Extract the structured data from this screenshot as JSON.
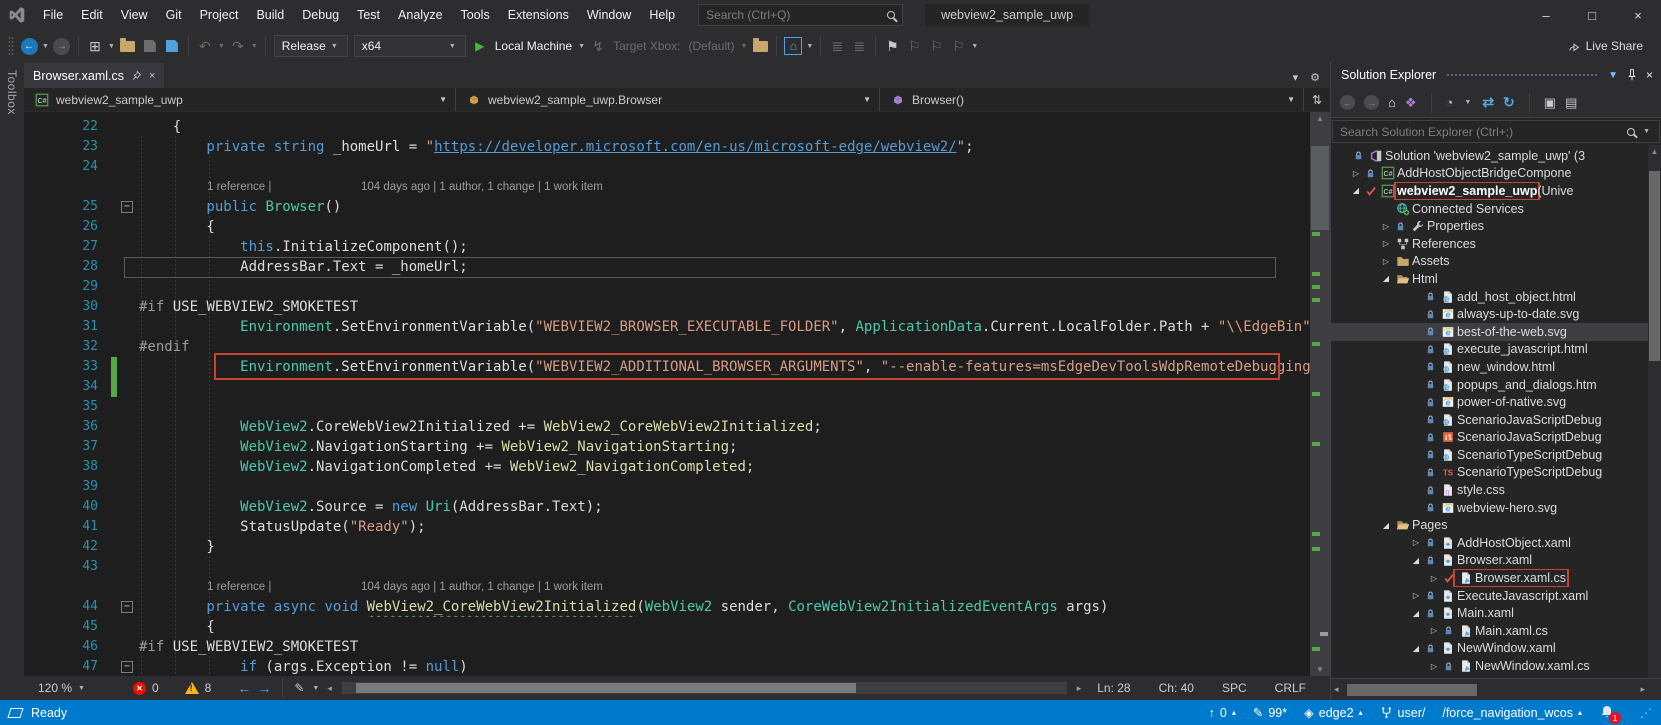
{
  "window": {
    "title": "webview2_sample_uwp"
  },
  "menu": {
    "items": [
      "File",
      "Edit",
      "View",
      "Git",
      "Project",
      "Build",
      "Debug",
      "Test",
      "Analyze",
      "Tools",
      "Extensions",
      "Window",
      "Help"
    ],
    "search_placeholder": "Search (Ctrl+Q)"
  },
  "toolbar": {
    "config": "Release",
    "platform": "x64",
    "run_target": "Local Machine",
    "target_xbox_label": "Target Xbox:",
    "target_xbox_value": "(Default)",
    "live_share_label": "Live Share",
    "icons": [
      "back-icon",
      "forward-icon",
      "new-item-icon",
      "open-folder-icon",
      "save-icon",
      "save-all-icon",
      "undo-icon",
      "redo-icon",
      "run-icon",
      "deploy-icon",
      "browse-folder-icon",
      "home-box-icon",
      "indent-icon",
      "outdent-icon",
      "bookmark-icon",
      "prev-bookmark-icon",
      "next-bookmark-icon",
      "clear-bookmarks-icon"
    ]
  },
  "toolbox_tab": "Toolbox",
  "editor": {
    "tab": {
      "label": "Browser.xaml.cs"
    },
    "breadcrumb": {
      "project": "webview2_sample_uwp",
      "type": "webview2_sample_uwp.Browser",
      "member": "Browser()"
    },
    "codelens": {
      "refs": "1 reference |",
      "meta": "104 days ago | 1 author, 1 change | 1 work item"
    },
    "bottom": {
      "zoom": "120 %",
      "errors": "0",
      "warnings": "8",
      "ln": "Ln: 28",
      "ch": "Ch: 40",
      "spc": "SPC",
      "crlf": "CRLF"
    },
    "lines": [
      {
        "n": 22,
        "ind": 4,
        "seg": [
          [
            "p",
            "{"
          ]
        ]
      },
      {
        "n": 23,
        "ind": 8,
        "seg": [
          [
            "k",
            "private"
          ],
          [
            "p",
            " "
          ],
          [
            "k",
            "string"
          ],
          [
            "p",
            " "
          ],
          [
            "p",
            "_homeUrl"
          ],
          [
            "p",
            " = "
          ],
          [
            "s",
            "\""
          ],
          [
            "u",
            "https://developer.microsoft.com/en-us/microsoft-edge/webview2/"
          ],
          [
            "s",
            "\""
          ],
          [
            "p",
            ";"
          ]
        ]
      },
      {
        "n": 24,
        "ind": 0,
        "seg": []
      },
      {
        "n": 25,
        "ind": 8,
        "cl": 1,
        "fold": 1,
        "seg": [
          [
            "k",
            "public"
          ],
          [
            "p",
            " "
          ],
          [
            "t",
            "Browser"
          ],
          [
            "p",
            "()"
          ]
        ]
      },
      {
        "n": 26,
        "ind": 8,
        "seg": [
          [
            "p",
            "{"
          ]
        ]
      },
      {
        "n": 27,
        "ind": 12,
        "seg": [
          [
            "k",
            "this"
          ],
          [
            "p",
            "."
          ],
          [
            "p",
            "InitializeComponent"
          ],
          [
            "p",
            "();"
          ]
        ]
      },
      {
        "n": 28,
        "ind": 12,
        "cur": 1,
        "seg": [
          [
            "p",
            "AddressBar.Text = _homeUrl;"
          ]
        ]
      },
      {
        "n": 29,
        "ind": 0,
        "seg": []
      },
      {
        "n": 30,
        "ind": 0,
        "seg": [
          [
            "d",
            "#if"
          ],
          [
            "p",
            " USE_WEBVIEW2_SMOKETEST"
          ]
        ]
      },
      {
        "n": 31,
        "ind": 12,
        "seg": [
          [
            "t",
            "Environment"
          ],
          [
            "p",
            "."
          ],
          [
            "p",
            "SetEnvironmentVariable"
          ],
          [
            "p",
            "("
          ],
          [
            "s",
            "\"WEBVIEW2_BROWSER_EXECUTABLE_FOLDER\""
          ],
          [
            "p",
            ", "
          ],
          [
            "t",
            "ApplicationData"
          ],
          [
            "p",
            ".Current.LocalFolder.Path + "
          ],
          [
            "s",
            "\"\\\\EdgeBin\""
          ],
          [
            "p",
            ");"
          ]
        ]
      },
      {
        "n": 32,
        "ind": 0,
        "seg": [
          [
            "d",
            "#endif"
          ]
        ]
      },
      {
        "n": 33,
        "ind": 12,
        "red": 1,
        "green": 1,
        "seg": [
          [
            "t",
            "Environment"
          ],
          [
            "p",
            "."
          ],
          [
            "p",
            "SetEnvironmentVariable"
          ],
          [
            "p",
            "("
          ],
          [
            "s",
            "\"WEBVIEW2_ADDITIONAL_BROWSER_ARGUMENTS\""
          ],
          [
            "p",
            ", "
          ],
          [
            "s",
            "\"--enable-features=msEdgeDevToolsWdpRemoteDebugging\""
          ],
          [
            "p",
            ");"
          ]
        ]
      },
      {
        "n": 34,
        "ind": 0,
        "green": 1,
        "seg": []
      },
      {
        "n": 35,
        "ind": 0,
        "seg": []
      },
      {
        "n": 36,
        "ind": 12,
        "seg": [
          [
            "t",
            "WebView2"
          ],
          [
            "p",
            ".CoreWebView2Initialized += "
          ],
          [
            "m",
            "WebView2_CoreWebView2Initialized"
          ],
          [
            "p",
            ";"
          ]
        ]
      },
      {
        "n": 37,
        "ind": 12,
        "seg": [
          [
            "t",
            "WebView2"
          ],
          [
            "p",
            ".NavigationStarting += "
          ],
          [
            "m",
            "WebView2_NavigationStarting"
          ],
          [
            "p",
            ";"
          ]
        ]
      },
      {
        "n": 38,
        "ind": 12,
        "seg": [
          [
            "t",
            "WebView2"
          ],
          [
            "p",
            ".NavigationCompleted += "
          ],
          [
            "m",
            "WebView2_NavigationCompleted"
          ],
          [
            "p",
            ";"
          ]
        ]
      },
      {
        "n": 39,
        "ind": 0,
        "seg": []
      },
      {
        "n": 40,
        "ind": 12,
        "seg": [
          [
            "t",
            "WebView2"
          ],
          [
            "p",
            ".Source = "
          ],
          [
            "k",
            "new"
          ],
          [
            "p",
            " "
          ],
          [
            "t",
            "Uri"
          ],
          [
            "p",
            "(AddressBar.Text);"
          ]
        ]
      },
      {
        "n": 41,
        "ind": 12,
        "seg": [
          [
            "p",
            "StatusUpdate("
          ],
          [
            "s",
            "\"Ready\""
          ],
          [
            "p",
            ");"
          ]
        ]
      },
      {
        "n": 42,
        "ind": 8,
        "seg": [
          [
            "p",
            "}"
          ]
        ]
      },
      {
        "n": 43,
        "ind": 0,
        "seg": []
      },
      {
        "n": 44,
        "ind": 8,
        "cl": 1,
        "fold": 1,
        "seg": [
          [
            "k",
            "private"
          ],
          [
            "p",
            " "
          ],
          [
            "k",
            "async"
          ],
          [
            "p",
            " "
          ],
          [
            "k",
            "void"
          ],
          [
            "p",
            " "
          ],
          [
            "g",
            "WebView2_CoreWebView2Initialized"
          ],
          [
            "p",
            "("
          ],
          [
            "t",
            "WebView2"
          ],
          [
            "p",
            " sender, "
          ],
          [
            "t",
            "CoreWebView2InitializedEventArgs"
          ],
          [
            "p",
            " args)"
          ]
        ]
      },
      {
        "n": 45,
        "ind": 8,
        "seg": [
          [
            "p",
            "{"
          ]
        ]
      },
      {
        "n": 46,
        "ind": 0,
        "seg": [
          [
            "d",
            "#if"
          ],
          [
            "p",
            " USE_WEBVIEW2_SMOKETEST"
          ]
        ]
      },
      {
        "n": 47,
        "ind": 12,
        "fold": 1,
        "seg": [
          [
            "k",
            "if"
          ],
          [
            "p",
            " (args.Exception != "
          ],
          [
            "k",
            "null"
          ],
          [
            "p",
            ")"
          ]
        ]
      }
    ]
  },
  "solution_explorer": {
    "title": "Solution Explorer",
    "search_placeholder": "Search Solution Explorer (Ctrl+;)",
    "toolbar_icons": [
      "back-icon",
      "forward-icon",
      "home-icon",
      "switch-views-icon",
      "pending-changes-filter-icon",
      "sync-icon",
      "refresh-icon",
      "nest-files-icon",
      "properties-icon"
    ],
    "items": [
      {
        "ind": 0,
        "lock": 1,
        "icon": "solution",
        "label": "Solution 'webview2_sample_uwp' (3"
      },
      {
        "ind": 1,
        "exp": "c",
        "lock": 1,
        "icon": "csproj",
        "label": "AddHostObjectBridgeCompone"
      },
      {
        "ind": 1,
        "exp": "o",
        "check": 1,
        "icon": "csproj",
        "label": "webview2_sample_uwp",
        "suffix": " (Unive",
        "bold": 1,
        "red": 1
      },
      {
        "ind": 2,
        "icon": "globe",
        "label": "Connected Services"
      },
      {
        "ind": 2,
        "exp": "c",
        "lock": 1,
        "icon": "wrench",
        "label": "Properties"
      },
      {
        "ind": 2,
        "exp": "c",
        "icon": "refs",
        "label": "References"
      },
      {
        "ind": 2,
        "exp": "c",
        "icon": "folder",
        "label": "Assets"
      },
      {
        "ind": 2,
        "exp": "o",
        "icon": "folder-open",
        "label": "Html"
      },
      {
        "ind": 3,
        "lock": 1,
        "icon": "html",
        "label": "add_host_object.html"
      },
      {
        "ind": 3,
        "lock": 1,
        "icon": "ie",
        "label": "always-up-to-date.svg"
      },
      {
        "ind": 3,
        "lock": 1,
        "icon": "ie",
        "label": "best-of-the-web.svg",
        "sel": 1
      },
      {
        "ind": 3,
        "lock": 1,
        "icon": "html",
        "label": "execute_javascript.html"
      },
      {
        "ind": 3,
        "lock": 1,
        "icon": "html",
        "label": "new_window.html"
      },
      {
        "ind": 3,
        "lock": 1,
        "icon": "html",
        "label": "popups_and_dialogs.htm"
      },
      {
        "ind": 3,
        "lock": 1,
        "icon": "ie",
        "label": "power-of-native.svg"
      },
      {
        "ind": 3,
        "lock": 1,
        "icon": "html",
        "label": "ScenarioJavaScriptDebug"
      },
      {
        "ind": 3,
        "lock": 1,
        "icon": "js",
        "label": "ScenarioJavaScriptDebug"
      },
      {
        "ind": 3,
        "lock": 1,
        "icon": "html",
        "label": "ScenarioTypeScriptDebug"
      },
      {
        "ind": 3,
        "lock": 1,
        "icon": "ts",
        "label": "ScenarioTypeScriptDebug"
      },
      {
        "ind": 3,
        "lock": 1,
        "icon": "css",
        "label": "style.css"
      },
      {
        "ind": 3,
        "lock": 1,
        "icon": "ie",
        "label": "webview-hero.svg"
      },
      {
        "ind": 2,
        "exp": "o",
        "icon": "folder-open",
        "label": "Pages"
      },
      {
        "ind": 3,
        "exp": "c",
        "lock": 1,
        "icon": "xaml",
        "label": "AddHostObject.xaml"
      },
      {
        "ind": 3,
        "exp": "o",
        "lock": 1,
        "icon": "xaml",
        "label": "Browser.xaml"
      },
      {
        "ind": 4,
        "exp": "c",
        "check": 1,
        "icon": "cs",
        "label": "Browser.xaml.cs",
        "red": 1
      },
      {
        "ind": 3,
        "exp": "c",
        "lock": 1,
        "icon": "xaml",
        "label": "ExecuteJavascript.xaml"
      },
      {
        "ind": 3,
        "exp": "o",
        "lock": 1,
        "icon": "xaml",
        "label": "Main.xaml"
      },
      {
        "ind": 4,
        "exp": "c",
        "lock": 1,
        "icon": "cs",
        "label": "Main.xaml.cs"
      },
      {
        "ind": 3,
        "exp": "o",
        "lock": 1,
        "icon": "xaml",
        "label": "NewWindow.xaml"
      },
      {
        "ind": 4,
        "exp": "c",
        "lock": 1,
        "icon": "cs",
        "label": "NewWindow.xaml.cs"
      }
    ]
  },
  "status_bar": {
    "ready": "Ready",
    "outgoing": "0",
    "pending_edits": "99*",
    "branch": "edge2",
    "repo": "user/",
    "target_path": "/force_navigation_wcos",
    "notifications": "1"
  }
}
